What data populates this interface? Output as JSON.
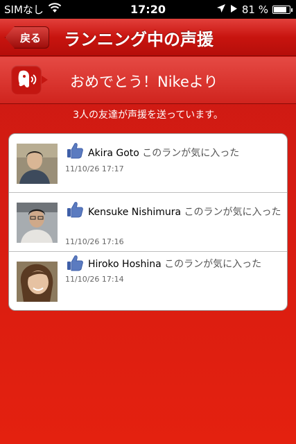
{
  "status_bar": {
    "carrier": "SIMなし",
    "time": "17:20",
    "battery": "81 %",
    "battery_level": 0.81
  },
  "nav": {
    "back_label": "戻る",
    "title": "ランニング中の声援"
  },
  "banner": {
    "message": "おめでとう！Nikeより"
  },
  "summary": "3人の友達が声援を送っています。",
  "cheers": [
    {
      "name": "Akira Goto",
      "message": "このランが気に入った",
      "time": "11/10/26  17:17"
    },
    {
      "name": "Kensuke Nishimura",
      "message": "このランが気に入った",
      "time": "11/10/26  17:16"
    },
    {
      "name": "Hiroko Hoshina",
      "message": "このランが気に入った",
      "time": "11/10/26  17:14"
    }
  ],
  "colors": {
    "accent_red": "#d51b12",
    "like_blue": "#5b7bc0"
  }
}
